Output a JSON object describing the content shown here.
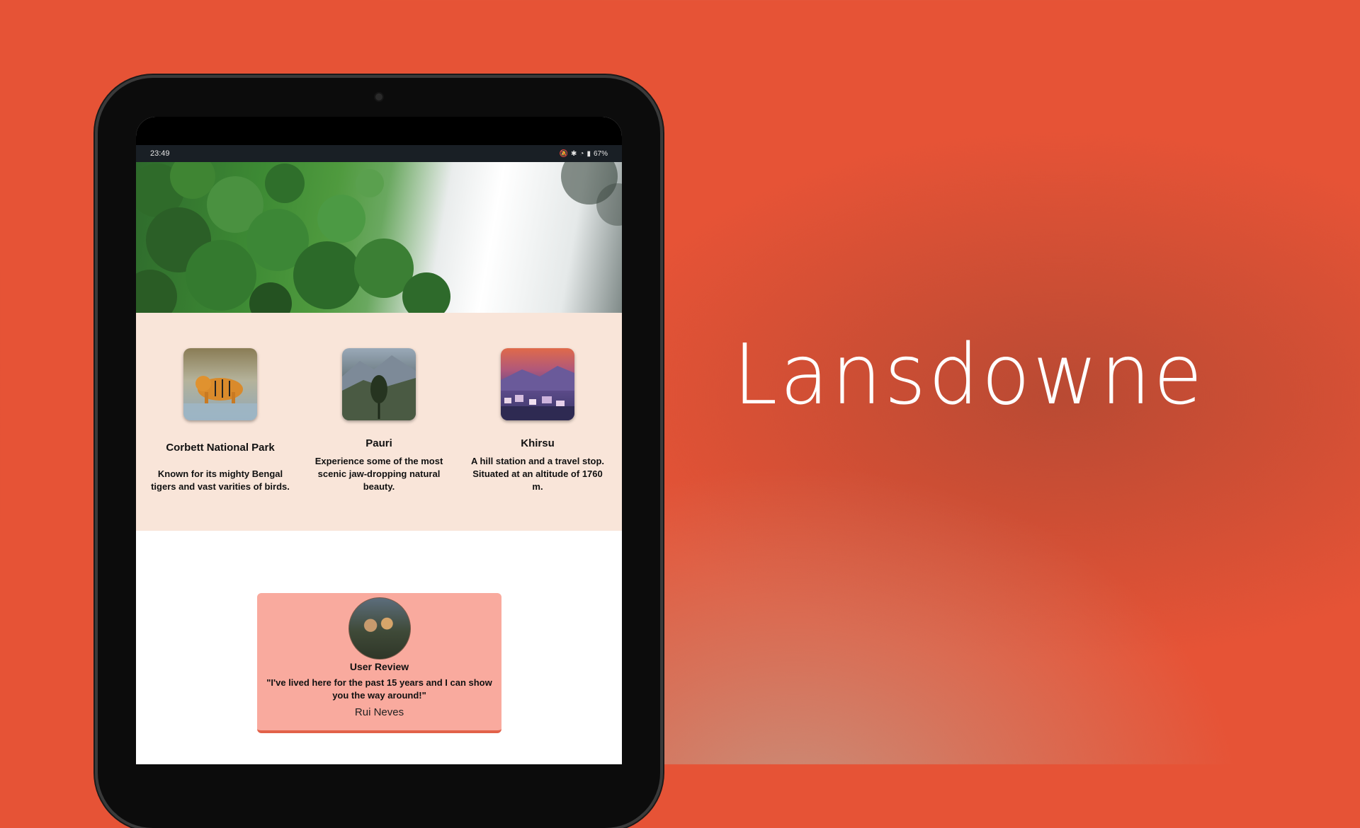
{
  "slide_title": "Lansdowne",
  "status_bar": {
    "time": "23:49",
    "battery": "67%",
    "icons": [
      "mute-icon",
      "bluetooth-icon",
      "wifi-icon",
      "battery-icon"
    ]
  },
  "places": [
    {
      "name": "Corbett National Park",
      "description": "Known for its mighty Bengal tigers and vast varities of birds.",
      "image": "tiger-photo"
    },
    {
      "name": "Pauri",
      "description": "Experience some of the most scenic jaw-dropping natural beauty.",
      "image": "mountain-photo"
    },
    {
      "name": "Khirsu",
      "description": "A hill station and a travel stop. Situated at an altitude of 1760 m.",
      "image": "town-sunset-photo"
    }
  ],
  "review": {
    "title": "User Review",
    "quote": "\"I've lived here for the past 15 years and I can show you the way around!\"",
    "author": "Rui Neves"
  },
  "colors": {
    "background": "#e65336",
    "places_section": "#f9e5d9",
    "review_card": "#f9aa9e",
    "review_border": "#e2624a"
  }
}
